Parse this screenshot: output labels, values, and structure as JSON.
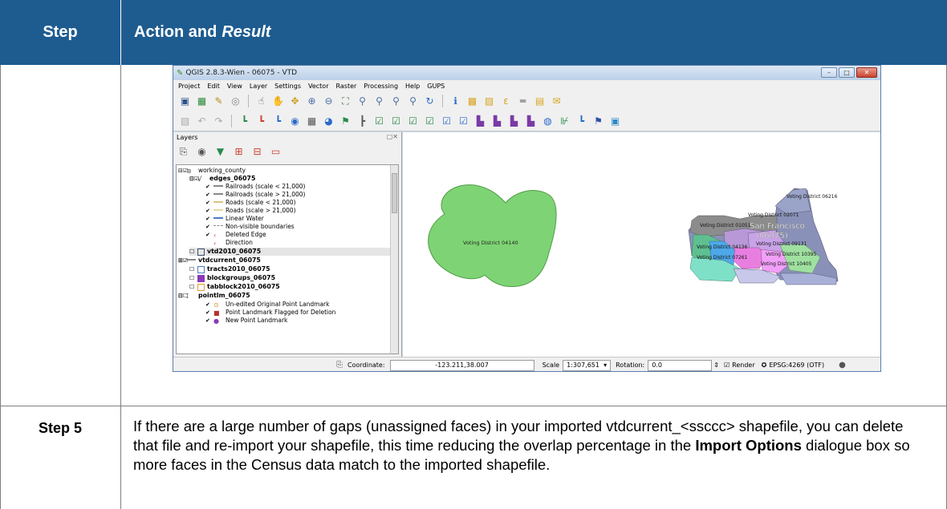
{
  "header": {
    "step": "Step",
    "action": "Action and",
    "result": "Result"
  },
  "qgis": {
    "title": "QGIS 2.8.3-Wien - 06075 - VTD",
    "menus": [
      "Project",
      "Edit",
      "View",
      "Layer",
      "Settings",
      "Vector",
      "Raster",
      "Processing",
      "Help",
      "GUPS"
    ],
    "layers_title": "Layers",
    "tree": [
      {
        "label": "working_county",
        "bold": false
      },
      {
        "label": "edges_06075",
        "bold": true
      },
      {
        "label": "Railroads (scale < 21,000)",
        "bold": false
      },
      {
        "label": "Railroads (scale > 21,000)",
        "bold": false
      },
      {
        "label": "Roads (scale < 21,000)",
        "bold": false
      },
      {
        "label": "Roads (scale > 21,000)",
        "bold": false
      },
      {
        "label": "Linear Water",
        "bold": false
      },
      {
        "label": "Non-visible boundaries",
        "bold": false
      },
      {
        "label": "Deleted Edge",
        "bold": false
      },
      {
        "label": "Direction",
        "bold": false
      },
      {
        "label": "vtd2010_06075",
        "bold": true
      },
      {
        "label": "vtdcurrent_06075",
        "bold": true
      },
      {
        "label": "tracts2010_06075",
        "bold": true
      },
      {
        "label": "blockgroups_06075",
        "bold": true
      },
      {
        "label": "tabblock2010_06075",
        "bold": true
      },
      {
        "label": "pointlm_06075",
        "bold": true
      },
      {
        "label": "Un-edited Original Point Landmark",
        "bold": false
      },
      {
        "label": "Point Landmark Flagged for Deletion",
        "bold": false
      },
      {
        "label": "New Point Landmark",
        "bold": false
      }
    ],
    "map_labels": {
      "d04140": "Voting District 04140",
      "d06216": "Voting District 06216",
      "d02071": "Voting District 02071",
      "d01051": "Voting District 01051",
      "sf": "San Francisco",
      "sf_code": "(06075)",
      "d04136": "Voting District 04136",
      "d07261": "Voting District 07261",
      "d10395": "Voting District 10395",
      "d10405": "Voting District 10405",
      "d09131": "Voting District 09131"
    },
    "status": {
      "coord_label": "Coordinate:",
      "coord_value": "-123.211,38.007",
      "scale_label": "Scale",
      "scale_value": "1:307,651",
      "rotation_label": "Rotation:",
      "rotation_value": "0.0",
      "render_label": "Render",
      "epsg": "EPSG:4269 (OTF)"
    }
  },
  "step5": {
    "label": "Step 5",
    "text_before": "If there are a large number of gaps (unassigned faces) in your imported vtdcurrent_<ssccc> shapefile, you can delete that file and re-import your shapefile, this time reducing the overlap percentage in the ",
    "bold": "Import Options",
    "text_after": " dialogue box so more faces in the Census data match to the imported shapefile."
  },
  "colors": {
    "header_bg": "#1e5c90",
    "district_green": "#7ed474"
  }
}
